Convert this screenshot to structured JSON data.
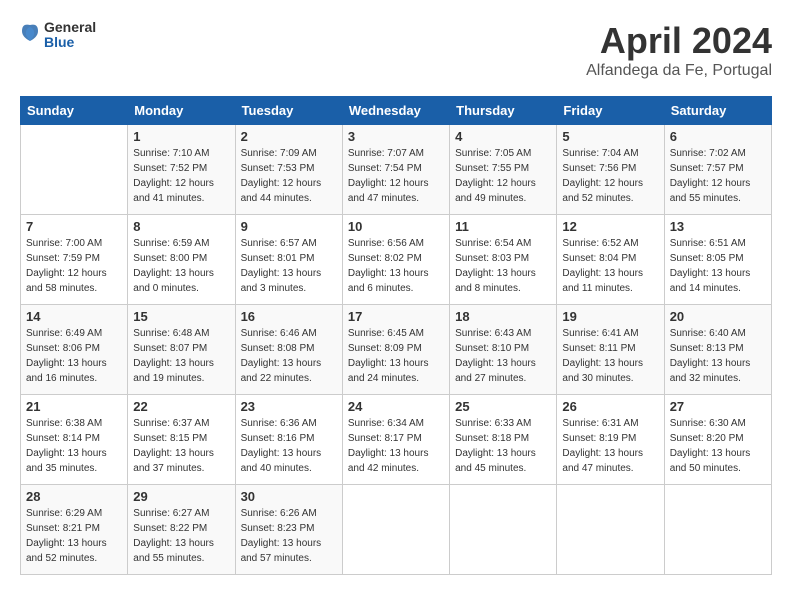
{
  "header": {
    "logo_line1": "General",
    "logo_line2": "Blue",
    "month_year": "April 2024",
    "location": "Alfandega da Fe, Portugal"
  },
  "weekdays": [
    "Sunday",
    "Monday",
    "Tuesday",
    "Wednesday",
    "Thursday",
    "Friday",
    "Saturday"
  ],
  "weeks": [
    [
      {
        "day": "",
        "sunrise": "",
        "sunset": "",
        "daylight": ""
      },
      {
        "day": "1",
        "sunrise": "Sunrise: 7:10 AM",
        "sunset": "Sunset: 7:52 PM",
        "daylight": "Daylight: 12 hours and 41 minutes."
      },
      {
        "day": "2",
        "sunrise": "Sunrise: 7:09 AM",
        "sunset": "Sunset: 7:53 PM",
        "daylight": "Daylight: 12 hours and 44 minutes."
      },
      {
        "day": "3",
        "sunrise": "Sunrise: 7:07 AM",
        "sunset": "Sunset: 7:54 PM",
        "daylight": "Daylight: 12 hours and 47 minutes."
      },
      {
        "day": "4",
        "sunrise": "Sunrise: 7:05 AM",
        "sunset": "Sunset: 7:55 PM",
        "daylight": "Daylight: 12 hours and 49 minutes."
      },
      {
        "day": "5",
        "sunrise": "Sunrise: 7:04 AM",
        "sunset": "Sunset: 7:56 PM",
        "daylight": "Daylight: 12 hours and 52 minutes."
      },
      {
        "day": "6",
        "sunrise": "Sunrise: 7:02 AM",
        "sunset": "Sunset: 7:57 PM",
        "daylight": "Daylight: 12 hours and 55 minutes."
      }
    ],
    [
      {
        "day": "7",
        "sunrise": "Sunrise: 7:00 AM",
        "sunset": "Sunset: 7:59 PM",
        "daylight": "Daylight: 12 hours and 58 minutes."
      },
      {
        "day": "8",
        "sunrise": "Sunrise: 6:59 AM",
        "sunset": "Sunset: 8:00 PM",
        "daylight": "Daylight: 13 hours and 0 minutes."
      },
      {
        "day": "9",
        "sunrise": "Sunrise: 6:57 AM",
        "sunset": "Sunset: 8:01 PM",
        "daylight": "Daylight: 13 hours and 3 minutes."
      },
      {
        "day": "10",
        "sunrise": "Sunrise: 6:56 AM",
        "sunset": "Sunset: 8:02 PM",
        "daylight": "Daylight: 13 hours and 6 minutes."
      },
      {
        "day": "11",
        "sunrise": "Sunrise: 6:54 AM",
        "sunset": "Sunset: 8:03 PM",
        "daylight": "Daylight: 13 hours and 8 minutes."
      },
      {
        "day": "12",
        "sunrise": "Sunrise: 6:52 AM",
        "sunset": "Sunset: 8:04 PM",
        "daylight": "Daylight: 13 hours and 11 minutes."
      },
      {
        "day": "13",
        "sunrise": "Sunrise: 6:51 AM",
        "sunset": "Sunset: 8:05 PM",
        "daylight": "Daylight: 13 hours and 14 minutes."
      }
    ],
    [
      {
        "day": "14",
        "sunrise": "Sunrise: 6:49 AM",
        "sunset": "Sunset: 8:06 PM",
        "daylight": "Daylight: 13 hours and 16 minutes."
      },
      {
        "day": "15",
        "sunrise": "Sunrise: 6:48 AM",
        "sunset": "Sunset: 8:07 PM",
        "daylight": "Daylight: 13 hours and 19 minutes."
      },
      {
        "day": "16",
        "sunrise": "Sunrise: 6:46 AM",
        "sunset": "Sunset: 8:08 PM",
        "daylight": "Daylight: 13 hours and 22 minutes."
      },
      {
        "day": "17",
        "sunrise": "Sunrise: 6:45 AM",
        "sunset": "Sunset: 8:09 PM",
        "daylight": "Daylight: 13 hours and 24 minutes."
      },
      {
        "day": "18",
        "sunrise": "Sunrise: 6:43 AM",
        "sunset": "Sunset: 8:10 PM",
        "daylight": "Daylight: 13 hours and 27 minutes."
      },
      {
        "day": "19",
        "sunrise": "Sunrise: 6:41 AM",
        "sunset": "Sunset: 8:11 PM",
        "daylight": "Daylight: 13 hours and 30 minutes."
      },
      {
        "day": "20",
        "sunrise": "Sunrise: 6:40 AM",
        "sunset": "Sunset: 8:13 PM",
        "daylight": "Daylight: 13 hours and 32 minutes."
      }
    ],
    [
      {
        "day": "21",
        "sunrise": "Sunrise: 6:38 AM",
        "sunset": "Sunset: 8:14 PM",
        "daylight": "Daylight: 13 hours and 35 minutes."
      },
      {
        "day": "22",
        "sunrise": "Sunrise: 6:37 AM",
        "sunset": "Sunset: 8:15 PM",
        "daylight": "Daylight: 13 hours and 37 minutes."
      },
      {
        "day": "23",
        "sunrise": "Sunrise: 6:36 AM",
        "sunset": "Sunset: 8:16 PM",
        "daylight": "Daylight: 13 hours and 40 minutes."
      },
      {
        "day": "24",
        "sunrise": "Sunrise: 6:34 AM",
        "sunset": "Sunset: 8:17 PM",
        "daylight": "Daylight: 13 hours and 42 minutes."
      },
      {
        "day": "25",
        "sunrise": "Sunrise: 6:33 AM",
        "sunset": "Sunset: 8:18 PM",
        "daylight": "Daylight: 13 hours and 45 minutes."
      },
      {
        "day": "26",
        "sunrise": "Sunrise: 6:31 AM",
        "sunset": "Sunset: 8:19 PM",
        "daylight": "Daylight: 13 hours and 47 minutes."
      },
      {
        "day": "27",
        "sunrise": "Sunrise: 6:30 AM",
        "sunset": "Sunset: 8:20 PM",
        "daylight": "Daylight: 13 hours and 50 minutes."
      }
    ],
    [
      {
        "day": "28",
        "sunrise": "Sunrise: 6:29 AM",
        "sunset": "Sunset: 8:21 PM",
        "daylight": "Daylight: 13 hours and 52 minutes."
      },
      {
        "day": "29",
        "sunrise": "Sunrise: 6:27 AM",
        "sunset": "Sunset: 8:22 PM",
        "daylight": "Daylight: 13 hours and 55 minutes."
      },
      {
        "day": "30",
        "sunrise": "Sunrise: 6:26 AM",
        "sunset": "Sunset: 8:23 PM",
        "daylight": "Daylight: 13 hours and 57 minutes."
      },
      {
        "day": "",
        "sunrise": "",
        "sunset": "",
        "daylight": ""
      },
      {
        "day": "",
        "sunrise": "",
        "sunset": "",
        "daylight": ""
      },
      {
        "day": "",
        "sunrise": "",
        "sunset": "",
        "daylight": ""
      },
      {
        "day": "",
        "sunrise": "",
        "sunset": "",
        "daylight": ""
      }
    ]
  ]
}
